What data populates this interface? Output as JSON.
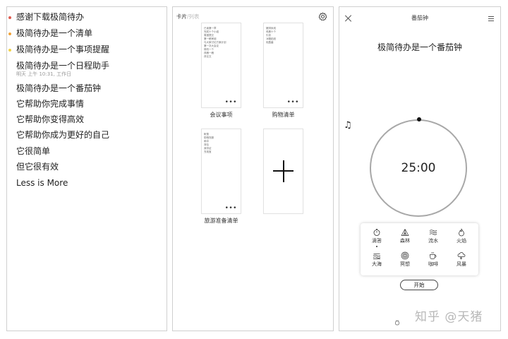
{
  "list_panel": {
    "items": [
      {
        "text": "感谢下载极简待办",
        "sub": "",
        "dot_color": "#e05a4e"
      },
      {
        "text": "极简待办是一个清单",
        "sub": "",
        "dot_color": "#f0a23a"
      },
      {
        "text": "极简待办是一个事项提醒",
        "sub": "",
        "dot_color": "#f1d24a"
      },
      {
        "text": "极简待办是一个日程助手",
        "sub": "明天 上午 10:31, 工作日",
        "dot_color": ""
      },
      {
        "text": "极简待办是一个番茄钟",
        "sub": "",
        "dot_color": ""
      },
      {
        "text": "它帮助你完成事情",
        "sub": "",
        "dot_color": ""
      },
      {
        "text": "它帮助你变得高效",
        "sub": "",
        "dot_color": ""
      },
      {
        "text": "它帮助你成为更好的自己",
        "sub": "",
        "dot_color": ""
      },
      {
        "text": "它很简单",
        "sub": "",
        "dot_color": ""
      },
      {
        "text": "但它很有效",
        "sub": "",
        "dot_color": ""
      },
      {
        "text": "Less is More",
        "sub": "",
        "dot_color": ""
      }
    ]
  },
  "cards_panel": {
    "tab_card": "卡片",
    "tab_sep": "/",
    "tab_list": "列表",
    "settings_icon": "gear-icon",
    "cards": [
      {
        "title": "会议事项",
        "lines": [
          "已读第一章",
          "完成十个小组",
          "周报提交",
          "第一稿审阅",
          "与大家讨论方案计划",
          "第一次大会议",
          "修改一个",
          "改稿一稿",
          "改论文"
        ]
      },
      {
        "title": "购物清单",
        "lines": [
          "猪排米线",
          "鸡蛋十个",
          "牛奶",
          "冰箱贴纸",
          "乳酸菌"
        ]
      },
      {
        "title": "旅游准备清单",
        "lines": [
          "帐篷",
          "防晒衣服",
          "雨伞",
          "背包",
          "身份证",
          "充电宝"
        ]
      }
    ],
    "more_label": "•••",
    "add_card_icon": "plus-icon"
  },
  "timer_panel": {
    "title": "番茄钟",
    "heading": "极简待办是一个番茄钟",
    "time": "25:00",
    "close_icon": "close-icon",
    "menu_icon": "menu-icon",
    "music_icon": "♫",
    "sounds": [
      {
        "label": "滴答",
        "icon": "stopwatch-icon",
        "selected": true
      },
      {
        "label": "森林",
        "icon": "tent-icon",
        "selected": false
      },
      {
        "label": "流水",
        "icon": "waves-icon",
        "selected": false
      },
      {
        "label": "火焰",
        "icon": "flame-icon",
        "selected": false
      },
      {
        "label": "大海",
        "icon": "sea-icon",
        "selected": false
      },
      {
        "label": "冥想",
        "icon": "spiral-icon",
        "selected": false
      },
      {
        "label": "咖啡",
        "icon": "coffee-icon",
        "selected": false
      },
      {
        "label": "风暴",
        "icon": "storm-icon",
        "selected": false
      }
    ],
    "start_label": "开始"
  },
  "watermark": "知乎 @天猪"
}
